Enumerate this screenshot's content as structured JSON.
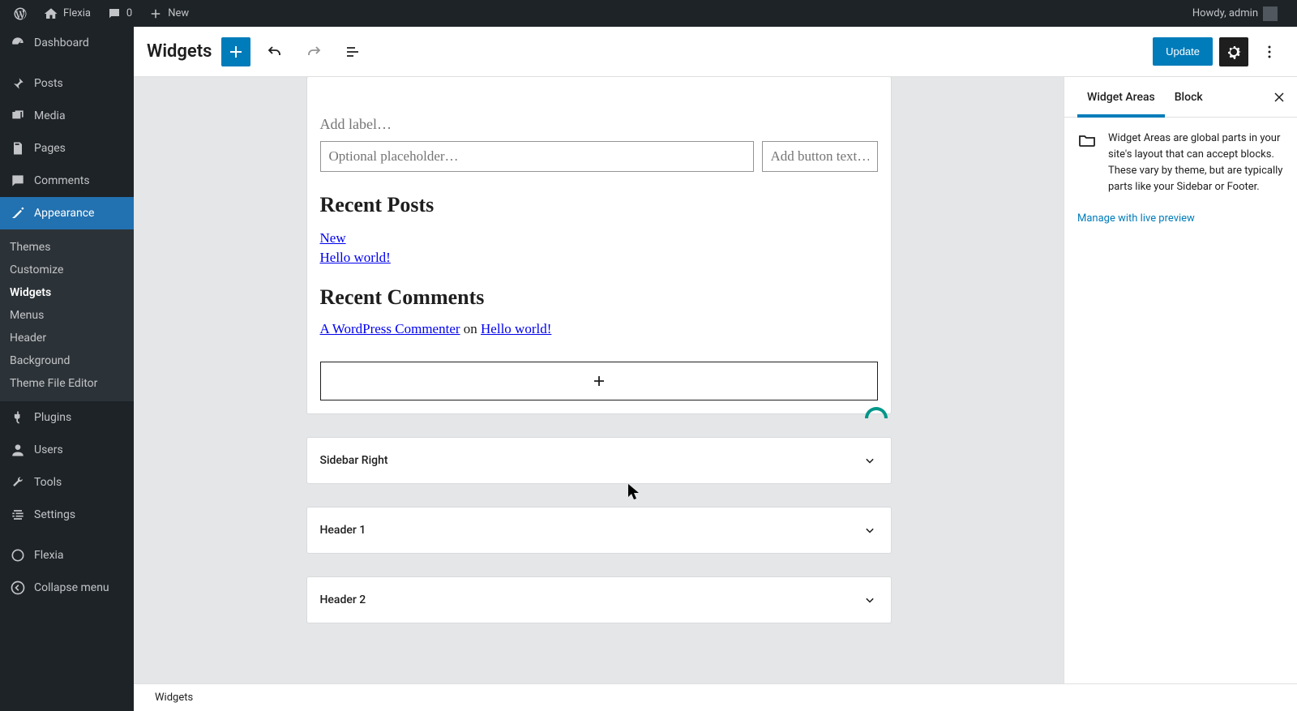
{
  "adminBar": {
    "site": "Flexia",
    "comments": "0",
    "new": "New",
    "howdy": "Howdy, admin"
  },
  "sidebar": {
    "items": [
      {
        "label": "Dashboard"
      },
      {
        "label": "Posts"
      },
      {
        "label": "Media"
      },
      {
        "label": "Pages"
      },
      {
        "label": "Comments"
      },
      {
        "label": "Appearance"
      },
      {
        "label": "Plugins"
      },
      {
        "label": "Users"
      },
      {
        "label": "Tools"
      },
      {
        "label": "Settings"
      },
      {
        "label": "Flexia"
      }
    ],
    "appearanceSub": [
      {
        "label": "Themes"
      },
      {
        "label": "Customize"
      },
      {
        "label": "Widgets"
      },
      {
        "label": "Menus"
      },
      {
        "label": "Header"
      },
      {
        "label": "Background"
      },
      {
        "label": "Theme File Editor"
      }
    ],
    "collapse": "Collapse menu"
  },
  "editorHeader": {
    "title": "Widgets",
    "update": "Update"
  },
  "canvas": {
    "labelPlaceholder": "Add label…",
    "searchPlaceholder": "Optional placeholder…",
    "buttonTextPlaceholder": "Add button text…",
    "recentPostsHeading": "Recent Posts",
    "posts": [
      {
        "title": "New"
      },
      {
        "title": "Hello world!"
      }
    ],
    "recentCommentsHeading": "Recent Comments",
    "comment": {
      "author": "A WordPress Commenter",
      "on": " on ",
      "post": "Hello world!"
    },
    "areas": [
      {
        "title": "Sidebar Right"
      },
      {
        "title": "Header 1"
      },
      {
        "title": "Header 2"
      }
    ]
  },
  "rightPanel": {
    "tabAreas": "Widget Areas",
    "tabBlock": "Block",
    "description": "Widget Areas are global parts in your site's layout that can accept blocks. These vary by theme, but are typically parts like your Sidebar or Footer.",
    "manageLink": "Manage with live preview"
  },
  "footer": {
    "breadcrumb": "Widgets"
  }
}
